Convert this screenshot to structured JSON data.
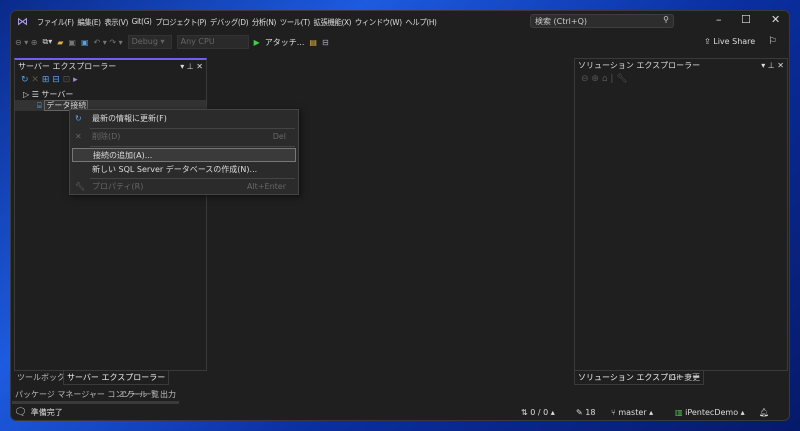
{
  "menu": [
    "ファイル(F)",
    "編集(E)",
    "表示(V)",
    "Git(G)",
    "プロジェクト(P)",
    "デバッグ(D)",
    "分析(N)",
    "ツール(T)",
    "拡張機能(X)",
    "ウィンドウ(W)",
    "ヘルプ(H)"
  ],
  "search": {
    "placeholder": "検索 (Ctrl+Q)"
  },
  "toolbar": {
    "config": "Debug",
    "platform": "Any CPU",
    "attach": "アタッチ...",
    "live_share": "Live Share"
  },
  "server_explorer": {
    "title": "サーバー エクスプローラー",
    "tree": [
      {
        "label": "サーバー"
      },
      {
        "label": "データ接続"
      }
    ]
  },
  "context_menu": [
    {
      "label": "最新の情報に更新(F)",
      "shortcut": "",
      "enabled": true
    },
    {
      "label": "削除(D)",
      "shortcut": "Del",
      "enabled": false
    },
    {
      "label": "接続の追加(A)...",
      "shortcut": "",
      "enabled": true,
      "highlighted": true
    },
    {
      "label": "新しい SQL Server データベースの作成(N)...",
      "shortcut": "",
      "enabled": true
    },
    {
      "label": "プロパティ(R)",
      "shortcut": "Alt+Enter",
      "enabled": false
    }
  ],
  "solution_explorer": {
    "title": "ソリューション エクスプローラー"
  },
  "left_tabs": [
    "ツールボックス",
    "サーバー エクスプローラー"
  ],
  "right_tabs": [
    "ソリューション エクスプローラー",
    "Git 変更"
  ],
  "bottom_tabs": [
    "パッケージ マネージャー コンソール",
    "エラー一覧",
    "出力"
  ],
  "status": {
    "text": "準備完了",
    "sync": "0 / 0",
    "edits": "18",
    "branch": "master",
    "repo": "iPentecDemo"
  },
  "colors": {
    "accent": "#7160e8",
    "bg": "#1f1f1f"
  }
}
